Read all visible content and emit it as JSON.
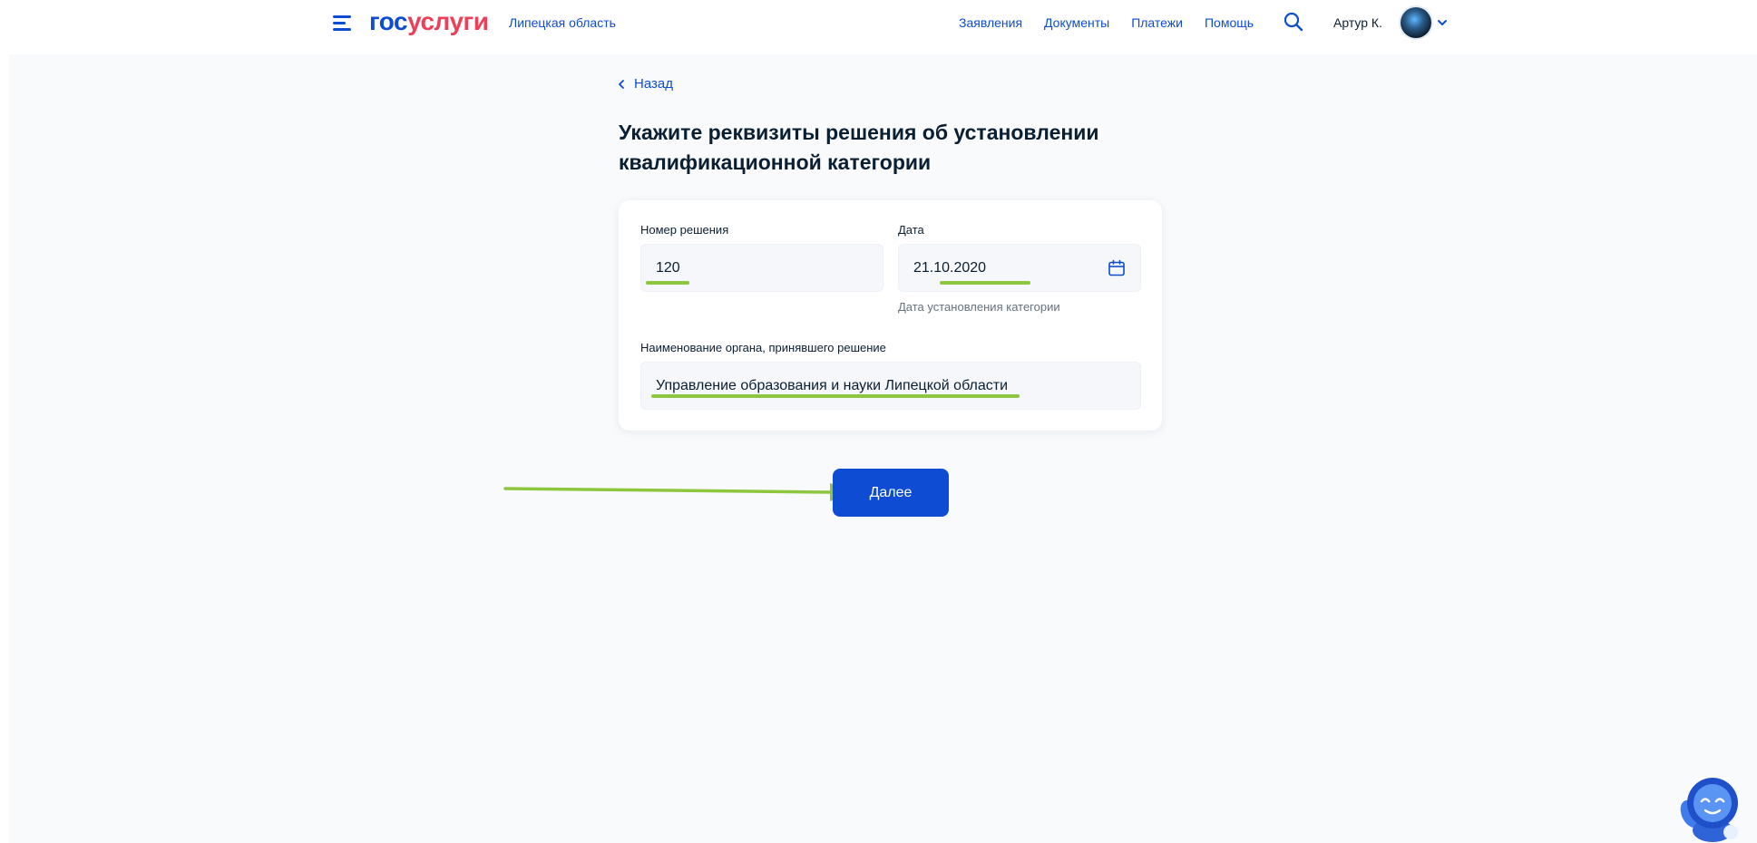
{
  "header": {
    "logo_part1": "гос",
    "logo_part2": "услуги",
    "region": "Липецкая область",
    "nav": [
      "Заявления",
      "Документы",
      "Платежи",
      "Помощь"
    ],
    "user_name": "Артур К."
  },
  "back_label": "Назад",
  "page_title": "Укажите реквизиты решения об установлении квалификационной категории",
  "form": {
    "decision_number": {
      "label": "Номер решения",
      "value": "120"
    },
    "date": {
      "label": "Дата",
      "value": "21.10.2020",
      "hint": "Дата установления категории"
    },
    "authority": {
      "label": "Наименование органа, принявшего решение",
      "value": "Управление образования и науки Липецкой области"
    }
  },
  "next_button": "Далее",
  "colors": {
    "brand_blue": "#0d4cd3",
    "brand_red": "#ee3f58",
    "annotation_green": "#8dc63f",
    "page_background": "#f8fafc"
  }
}
